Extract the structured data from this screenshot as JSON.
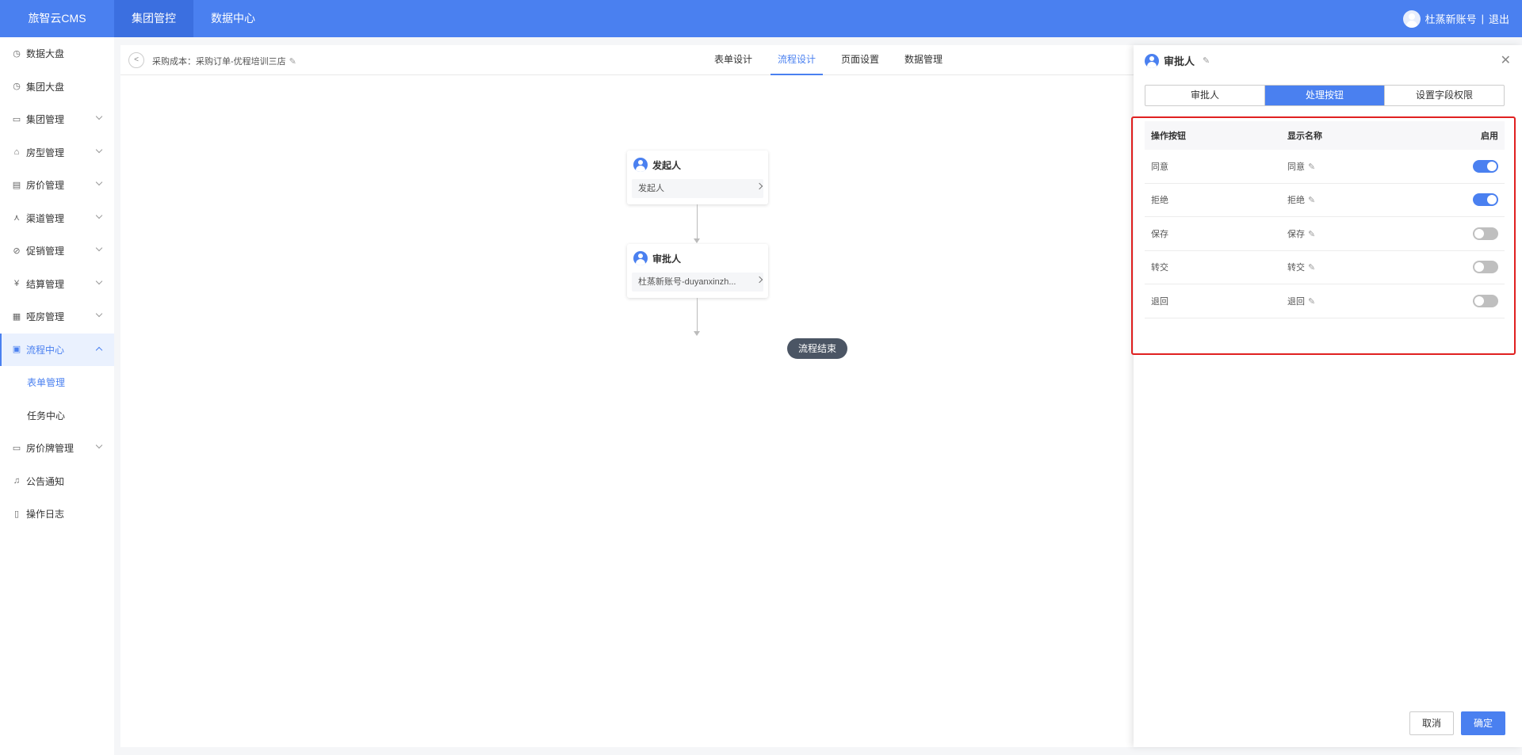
{
  "brand": "旅智云CMS",
  "topnav": [
    {
      "label": "集团管控"
    },
    {
      "label": "数据中心"
    }
  ],
  "user": {
    "name": "杜蒸新账号",
    "separator": "|",
    "logout": "退出"
  },
  "sidebar": {
    "items": [
      {
        "label": "数据大盘",
        "icon": "clock-icon"
      },
      {
        "label": "集团大盘",
        "icon": "clock-icon"
      },
      {
        "label": "集团管理",
        "icon": "monitor-icon"
      },
      {
        "label": "房型管理",
        "icon": "home-icon"
      },
      {
        "label": "房价管理",
        "icon": "card-icon"
      },
      {
        "label": "渠道管理",
        "icon": "share-icon"
      },
      {
        "label": "促销管理",
        "icon": "tag-icon"
      },
      {
        "label": "结算管理",
        "icon": "yen-icon"
      },
      {
        "label": "哑房管理",
        "icon": "doc-icon"
      },
      {
        "label": "流程中心",
        "icon": "clipboard-icon"
      },
      {
        "label": "表单管理"
      },
      {
        "label": "任务中心"
      },
      {
        "label": "房价牌管理",
        "icon": "board-icon"
      },
      {
        "label": "公告通知",
        "icon": "bell-icon"
      },
      {
        "label": "操作日志",
        "icon": "file-icon"
      }
    ]
  },
  "canvas": {
    "title": "采购成本：采购订单-优程培训三店",
    "tabs": [
      {
        "label": "表单设计"
      },
      {
        "label": "流程设计"
      },
      {
        "label": "页面设置"
      },
      {
        "label": "数据管理"
      }
    ],
    "nodes": [
      {
        "title": "发起人",
        "body": "发起人"
      },
      {
        "title": "审批人",
        "body": "杜蒸新账号-duyanxinzh..."
      }
    ],
    "end_label": "流程结束"
  },
  "panel": {
    "title": "审批人",
    "tabs": [
      {
        "label": "审批人"
      },
      {
        "label": "处理按钮"
      },
      {
        "label": "设置字段权限"
      }
    ],
    "columns": [
      "操作按钮",
      "显示名称",
      "启用"
    ],
    "rows": [
      {
        "action": "同意",
        "display": "同意",
        "enabled": true
      },
      {
        "action": "拒绝",
        "display": "拒绝",
        "enabled": true
      },
      {
        "action": "保存",
        "display": "保存",
        "enabled": false
      },
      {
        "action": "转交",
        "display": "转交",
        "enabled": false
      },
      {
        "action": "退回",
        "display": "退回",
        "enabled": false
      }
    ],
    "cancel_label": "取消",
    "ok_label": "确定"
  },
  "colors": {
    "accent": "#4a80f0",
    "highlight": "#e02020",
    "end_node": "#4b5564"
  }
}
